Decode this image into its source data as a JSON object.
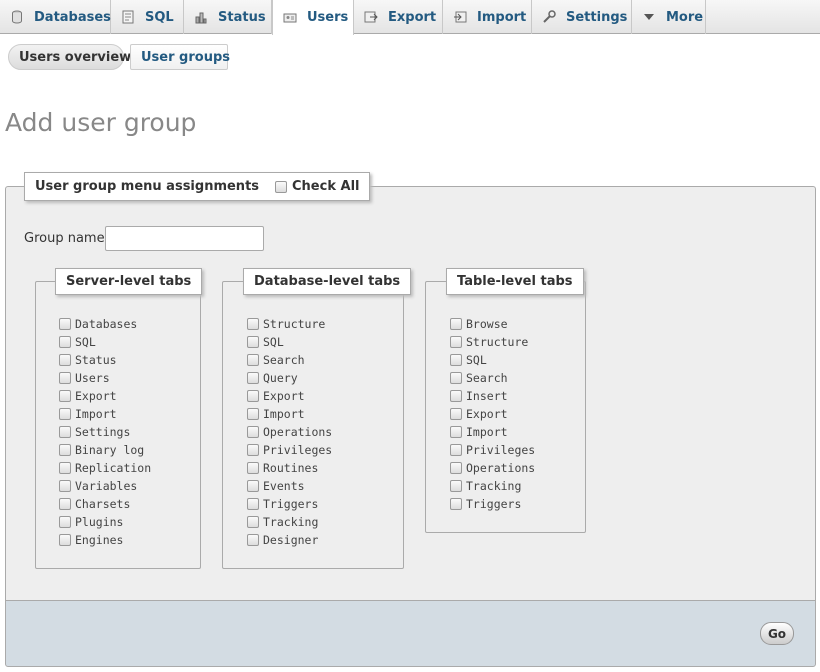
{
  "topnav": {
    "tabs": [
      {
        "label": "Databases",
        "icon": "database-icon"
      },
      {
        "label": "SQL",
        "icon": "sql-icon"
      },
      {
        "label": "Status",
        "icon": "status-icon"
      },
      {
        "label": "Users",
        "icon": "users-icon",
        "active": true
      },
      {
        "label": "Export",
        "icon": "export-icon"
      },
      {
        "label": "Import",
        "icon": "import-icon"
      },
      {
        "label": "Settings",
        "icon": "settings-icon"
      },
      {
        "label": "More",
        "icon": "caret-down-icon"
      }
    ]
  },
  "subnav": {
    "overview_label": "Users overview",
    "groups_label": "User groups"
  },
  "page_title": "Add user group",
  "form": {
    "legend": "User group menu assignments",
    "check_all_label": "Check All",
    "group_name_label": "Group name:",
    "group_name_value": "",
    "server": {
      "legend": "Server-level tabs",
      "items": [
        "Databases",
        "SQL",
        "Status",
        "Users",
        "Export",
        "Import",
        "Settings",
        "Binary log",
        "Replication",
        "Variables",
        "Charsets",
        "Plugins",
        "Engines"
      ]
    },
    "database": {
      "legend": "Database-level tabs",
      "items": [
        "Structure",
        "SQL",
        "Search",
        "Query",
        "Export",
        "Import",
        "Operations",
        "Privileges",
        "Routines",
        "Events",
        "Triggers",
        "Tracking",
        "Designer"
      ]
    },
    "table": {
      "legend": "Table-level tabs",
      "items": [
        "Browse",
        "Structure",
        "SQL",
        "Search",
        "Insert",
        "Export",
        "Import",
        "Privileges",
        "Operations",
        "Tracking",
        "Triggers"
      ]
    },
    "go_label": "Go"
  }
}
